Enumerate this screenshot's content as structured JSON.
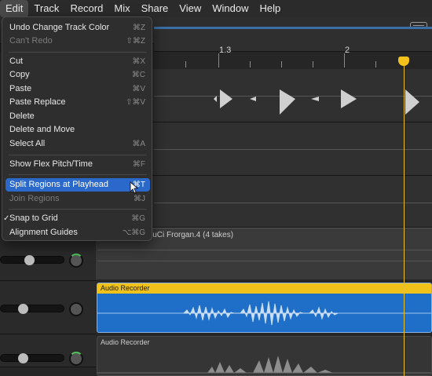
{
  "menubar": {
    "items": [
      "Edit",
      "Track",
      "Record",
      "Mix",
      "Share",
      "View",
      "Window",
      "Help"
    ],
    "active_index": 0
  },
  "ruler": {
    "labels": [
      "1.3",
      "2"
    ]
  },
  "edit_menu": {
    "items": [
      {
        "label": "Undo Change Track Color",
        "shortcut": "⌘Z",
        "disabled": false
      },
      {
        "label": "Can't Redo",
        "shortcut": "⇧⌘Z",
        "disabled": true
      },
      {
        "label": "Cut",
        "shortcut": "⌘X",
        "disabled": false
      },
      {
        "label": "Copy",
        "shortcut": "⌘C",
        "disabled": false
      },
      {
        "label": "Paste",
        "shortcut": "⌘V",
        "disabled": false
      },
      {
        "label": "Paste Replace",
        "shortcut": "⇧⌘V",
        "disabled": false
      },
      {
        "label": "Delete",
        "shortcut": "",
        "disabled": false
      },
      {
        "label": "Delete and Move",
        "shortcut": "",
        "disabled": false
      },
      {
        "label": "Select All",
        "shortcut": "⌘A",
        "disabled": false
      },
      {
        "label": "Show Flex Pitch/Time",
        "shortcut": "⌘F",
        "disabled": false
      },
      {
        "label": "Split Regions at Playhead",
        "shortcut": "⌘T",
        "disabled": false,
        "highlighted": true
      },
      {
        "label": "Join Regions",
        "shortcut": "⌘J",
        "disabled": true
      },
      {
        "label": "Snap to Grid",
        "shortcut": "⌘G",
        "disabled": false,
        "checked": true
      },
      {
        "label": "Alignment Guides",
        "shortcut": "⌥⌘G",
        "disabled": false
      }
    ]
  },
  "regions": {
    "mid_label": "luCi Frorgan.4 (4 takes)",
    "selected_label": "Audio Recorder",
    "other_label": "Audio Recorder"
  },
  "icons": {
    "toolbar": "library-icon",
    "cursor": "mouse-pointer-icon"
  },
  "colors": {
    "highlight": "#2a68c9",
    "playhead": "#f3c31c",
    "region_blue": "#1f6fc8"
  }
}
